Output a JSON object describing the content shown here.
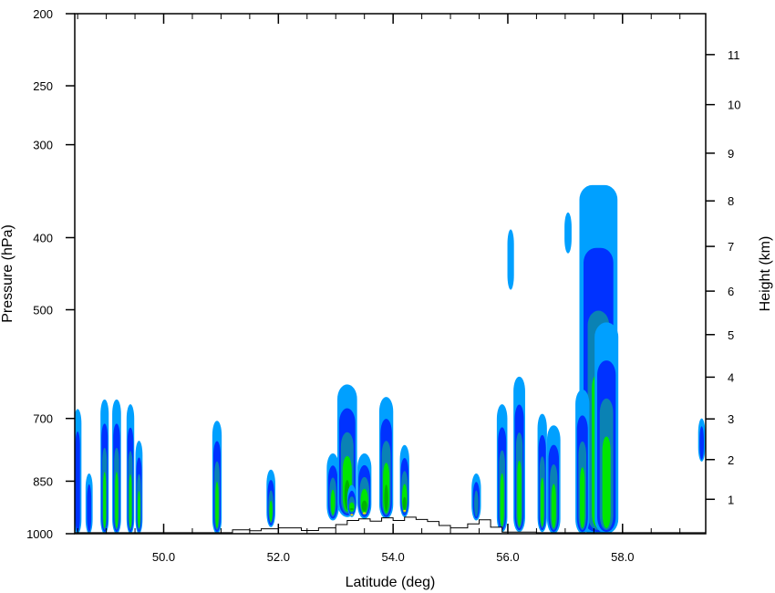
{
  "chart_data": {
    "type": "contour",
    "xlabel": "Latitude (deg)",
    "ylabel_left": "Pressure (hPa)",
    "ylabel_right": "Height (km)",
    "xlim": [
      48.45,
      59.45
    ],
    "ylim_pressure": [
      1000,
      200
    ],
    "pressure_scale": "log",
    "x_ticks": [
      {
        "value": 50,
        "label": "50.0"
      },
      {
        "value": 52,
        "label": "52.0"
      },
      {
        "value": 54,
        "label": "54.0"
      },
      {
        "value": 56,
        "label": "56.0"
      },
      {
        "value": 58,
        "label": "58.0"
      }
    ],
    "x_minor_step": 0.5,
    "pressure_ticks": [
      {
        "value": 200,
        "label": "200"
      },
      {
        "value": 250,
        "label": "250"
      },
      {
        "value": 300,
        "label": "300"
      },
      {
        "value": 400,
        "label": "400"
      },
      {
        "value": 500,
        "label": "500"
      },
      {
        "value": 700,
        "label": "700"
      },
      {
        "value": 850,
        "label": "850"
      },
      {
        "value": 1000,
        "label": "1000"
      }
    ],
    "height_ticks": [
      {
        "value": 1,
        "pressure": 899,
        "label": "1"
      },
      {
        "value": 2,
        "pressure": 795,
        "label": "2"
      },
      {
        "value": 3,
        "pressure": 701,
        "label": "3"
      },
      {
        "value": 4,
        "pressure": 616,
        "label": "4"
      },
      {
        "value": 5,
        "pressure": 540,
        "label": "5"
      },
      {
        "value": 6,
        "pressure": 472,
        "label": "6"
      },
      {
        "value": 7,
        "pressure": 411,
        "label": "7"
      },
      {
        "value": 8,
        "pressure": 357,
        "label": "8"
      },
      {
        "value": 9,
        "pressure": 308,
        "label": "9"
      },
      {
        "value": 10,
        "pressure": 265,
        "label": "10"
      },
      {
        "value": 11,
        "pressure": 227,
        "label": "11"
      }
    ],
    "levels": [
      {
        "color": "#00a0ff"
      },
      {
        "color": "#0032ff"
      },
      {
        "color": "#0a82b4"
      },
      {
        "color": "#00e600"
      },
      {
        "color": "#00b400"
      },
      {
        "color": "#ffd700"
      }
    ],
    "cells": [
      {
        "lat": 48.5,
        "w": 0.07,
        "top": 680,
        "bottom": 1000,
        "levels": 2,
        "anchor": "left"
      },
      {
        "lat": 48.7,
        "w": 0.06,
        "top": 830,
        "bottom": 1000,
        "levels": 2
      },
      {
        "lat": 48.97,
        "w": 0.08,
        "top": 660,
        "bottom": 1000,
        "levels": 4
      },
      {
        "lat": 49.18,
        "w": 0.09,
        "top": 660,
        "bottom": 1000,
        "levels": 4
      },
      {
        "lat": 49.42,
        "w": 0.07,
        "top": 670,
        "bottom": 1000,
        "levels": 4
      },
      {
        "lat": 49.57,
        "w": 0.06,
        "top": 750,
        "bottom": 1000,
        "levels": 4
      },
      {
        "lat": 50.93,
        "w": 0.1,
        "top": 705,
        "bottom": 1000,
        "levels": 4
      },
      {
        "lat": 51.87,
        "w": 0.09,
        "top": 820,
        "bottom": 980,
        "levels": 4
      },
      {
        "lat": 52.95,
        "w": 0.15,
        "top": 780,
        "bottom": 960,
        "levels": 4
      },
      {
        "lat": 53.2,
        "w": 0.28,
        "top": 630,
        "bottom": 950,
        "levels": 5
      },
      {
        "lat": 53.5,
        "w": 0.18,
        "top": 780,
        "bottom": 955,
        "levels": 6
      },
      {
        "lat": 53.28,
        "w": 0.1,
        "top": 860,
        "bottom": 950,
        "levels": 6
      },
      {
        "lat": 53.88,
        "w": 0.18,
        "top": 655,
        "bottom": 955,
        "levels": 5
      },
      {
        "lat": 54.2,
        "w": 0.1,
        "top": 760,
        "bottom": 950,
        "levels": 6
      },
      {
        "lat": 55.45,
        "w": 0.1,
        "top": 830,
        "bottom": 960,
        "levels": 3
      },
      {
        "lat": 55.9,
        "w": 0.12,
        "top": 670,
        "bottom": 995,
        "levels": 4
      },
      {
        "lat": 56.2,
        "w": 0.14,
        "top": 615,
        "bottom": 995,
        "levels": 4
      },
      {
        "lat": 56.05,
        "w": 0.05,
        "top": 390,
        "bottom": 470,
        "levels": 1
      },
      {
        "lat": 56.6,
        "w": 0.1,
        "top": 690,
        "bottom": 995,
        "levels": 4
      },
      {
        "lat": 56.8,
        "w": 0.17,
        "top": 715,
        "bottom": 1000,
        "levels": 4
      },
      {
        "lat": 57.58,
        "w": 0.6,
        "top": 340,
        "bottom": 1000,
        "levels": 4
      },
      {
        "lat": 57.3,
        "w": 0.18,
        "top": 640,
        "bottom": 1000,
        "levels": 4
      },
      {
        "lat": 57.72,
        "w": 0.35,
        "top": 520,
        "bottom": 1000,
        "levels": 4
      },
      {
        "lat": 57.05,
        "w": 0.06,
        "top": 370,
        "bottom": 420,
        "levels": 1
      },
      {
        "lat": 59.38,
        "w": 0.06,
        "top": 700,
        "bottom": 800,
        "levels": 2,
        "anchor": "right"
      }
    ],
    "terrain": [
      [
        48.45,
        997
      ],
      [
        51.0,
        997
      ],
      [
        51.2,
        988
      ],
      [
        51.5,
        991
      ],
      [
        51.7,
        985
      ],
      [
        52.0,
        982
      ],
      [
        52.4,
        990
      ],
      [
        52.7,
        982
      ],
      [
        53.0,
        972
      ],
      [
        53.2,
        960
      ],
      [
        53.4,
        955
      ],
      [
        53.6,
        962
      ],
      [
        53.8,
        952
      ],
      [
        54.0,
        960
      ],
      [
        54.2,
        950
      ],
      [
        54.4,
        957
      ],
      [
        54.6,
        963
      ],
      [
        54.8,
        975
      ],
      [
        55.0,
        982
      ],
      [
        55.3,
        970
      ],
      [
        55.5,
        958
      ],
      [
        55.7,
        980
      ],
      [
        55.9,
        995
      ],
      [
        56.5,
        997
      ],
      [
        59.45,
        997
      ]
    ]
  }
}
